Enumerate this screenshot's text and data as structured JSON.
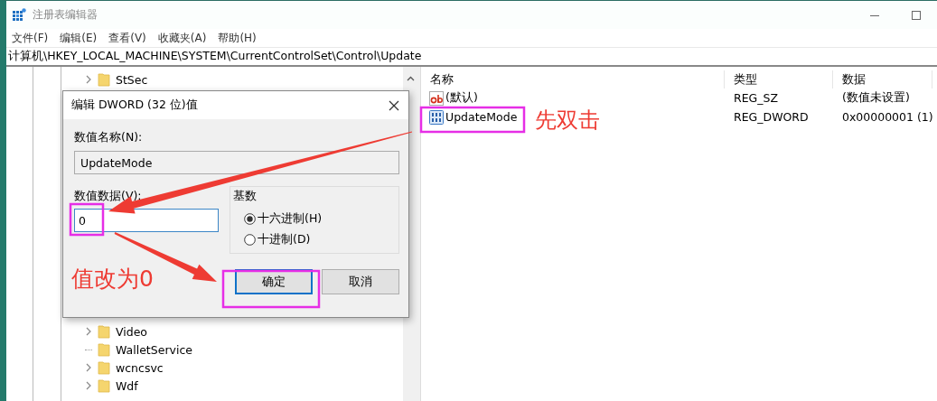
{
  "window": {
    "title": "注册表编辑器"
  },
  "menu": [
    "文件(F)",
    "编辑(E)",
    "查看(V)",
    "收藏夹(A)",
    "帮助(H)"
  ],
  "address": "计算机\\HKEY_LOCAL_MACHINE\\SYSTEM\\CurrentControlSet\\Control\\Update",
  "tree": {
    "items_above_dialog": [
      {
        "label": "StSec",
        "expandable": true
      }
    ],
    "items_below_dialog": [
      {
        "label": "Video",
        "expandable": true
      },
      {
        "label": "WalletService",
        "expandable": false
      },
      {
        "label": "wcncsvc",
        "expandable": true
      },
      {
        "label": "Wdf",
        "expandable": true
      }
    ]
  },
  "values": {
    "columns": [
      "名称",
      "类型",
      "数据"
    ],
    "rows": [
      {
        "name": "(默认)",
        "type": "REG_SZ",
        "data": "(数值未设置)",
        "kind": "string"
      },
      {
        "name": "UpdateMode",
        "type": "REG_DWORD",
        "data": "0x00000001 (1)",
        "kind": "binary"
      }
    ]
  },
  "dialog": {
    "title": "编辑 DWORD (32 位)值",
    "name_label": "数值名称(N):",
    "name_value": "UpdateMode",
    "data_label": "数值数据(V):",
    "data_value": "0",
    "base_label": "基数",
    "radios": [
      {
        "label": "十六进制(H)",
        "selected": true
      },
      {
        "label": "十进制(D)",
        "selected": false
      }
    ],
    "buttons": [
      {
        "label": "确定",
        "default": true
      },
      {
        "label": "取消",
        "default": false
      }
    ]
  },
  "annotations": [
    {
      "text": "先双击"
    },
    {
      "text": "值改为0"
    }
  ]
}
